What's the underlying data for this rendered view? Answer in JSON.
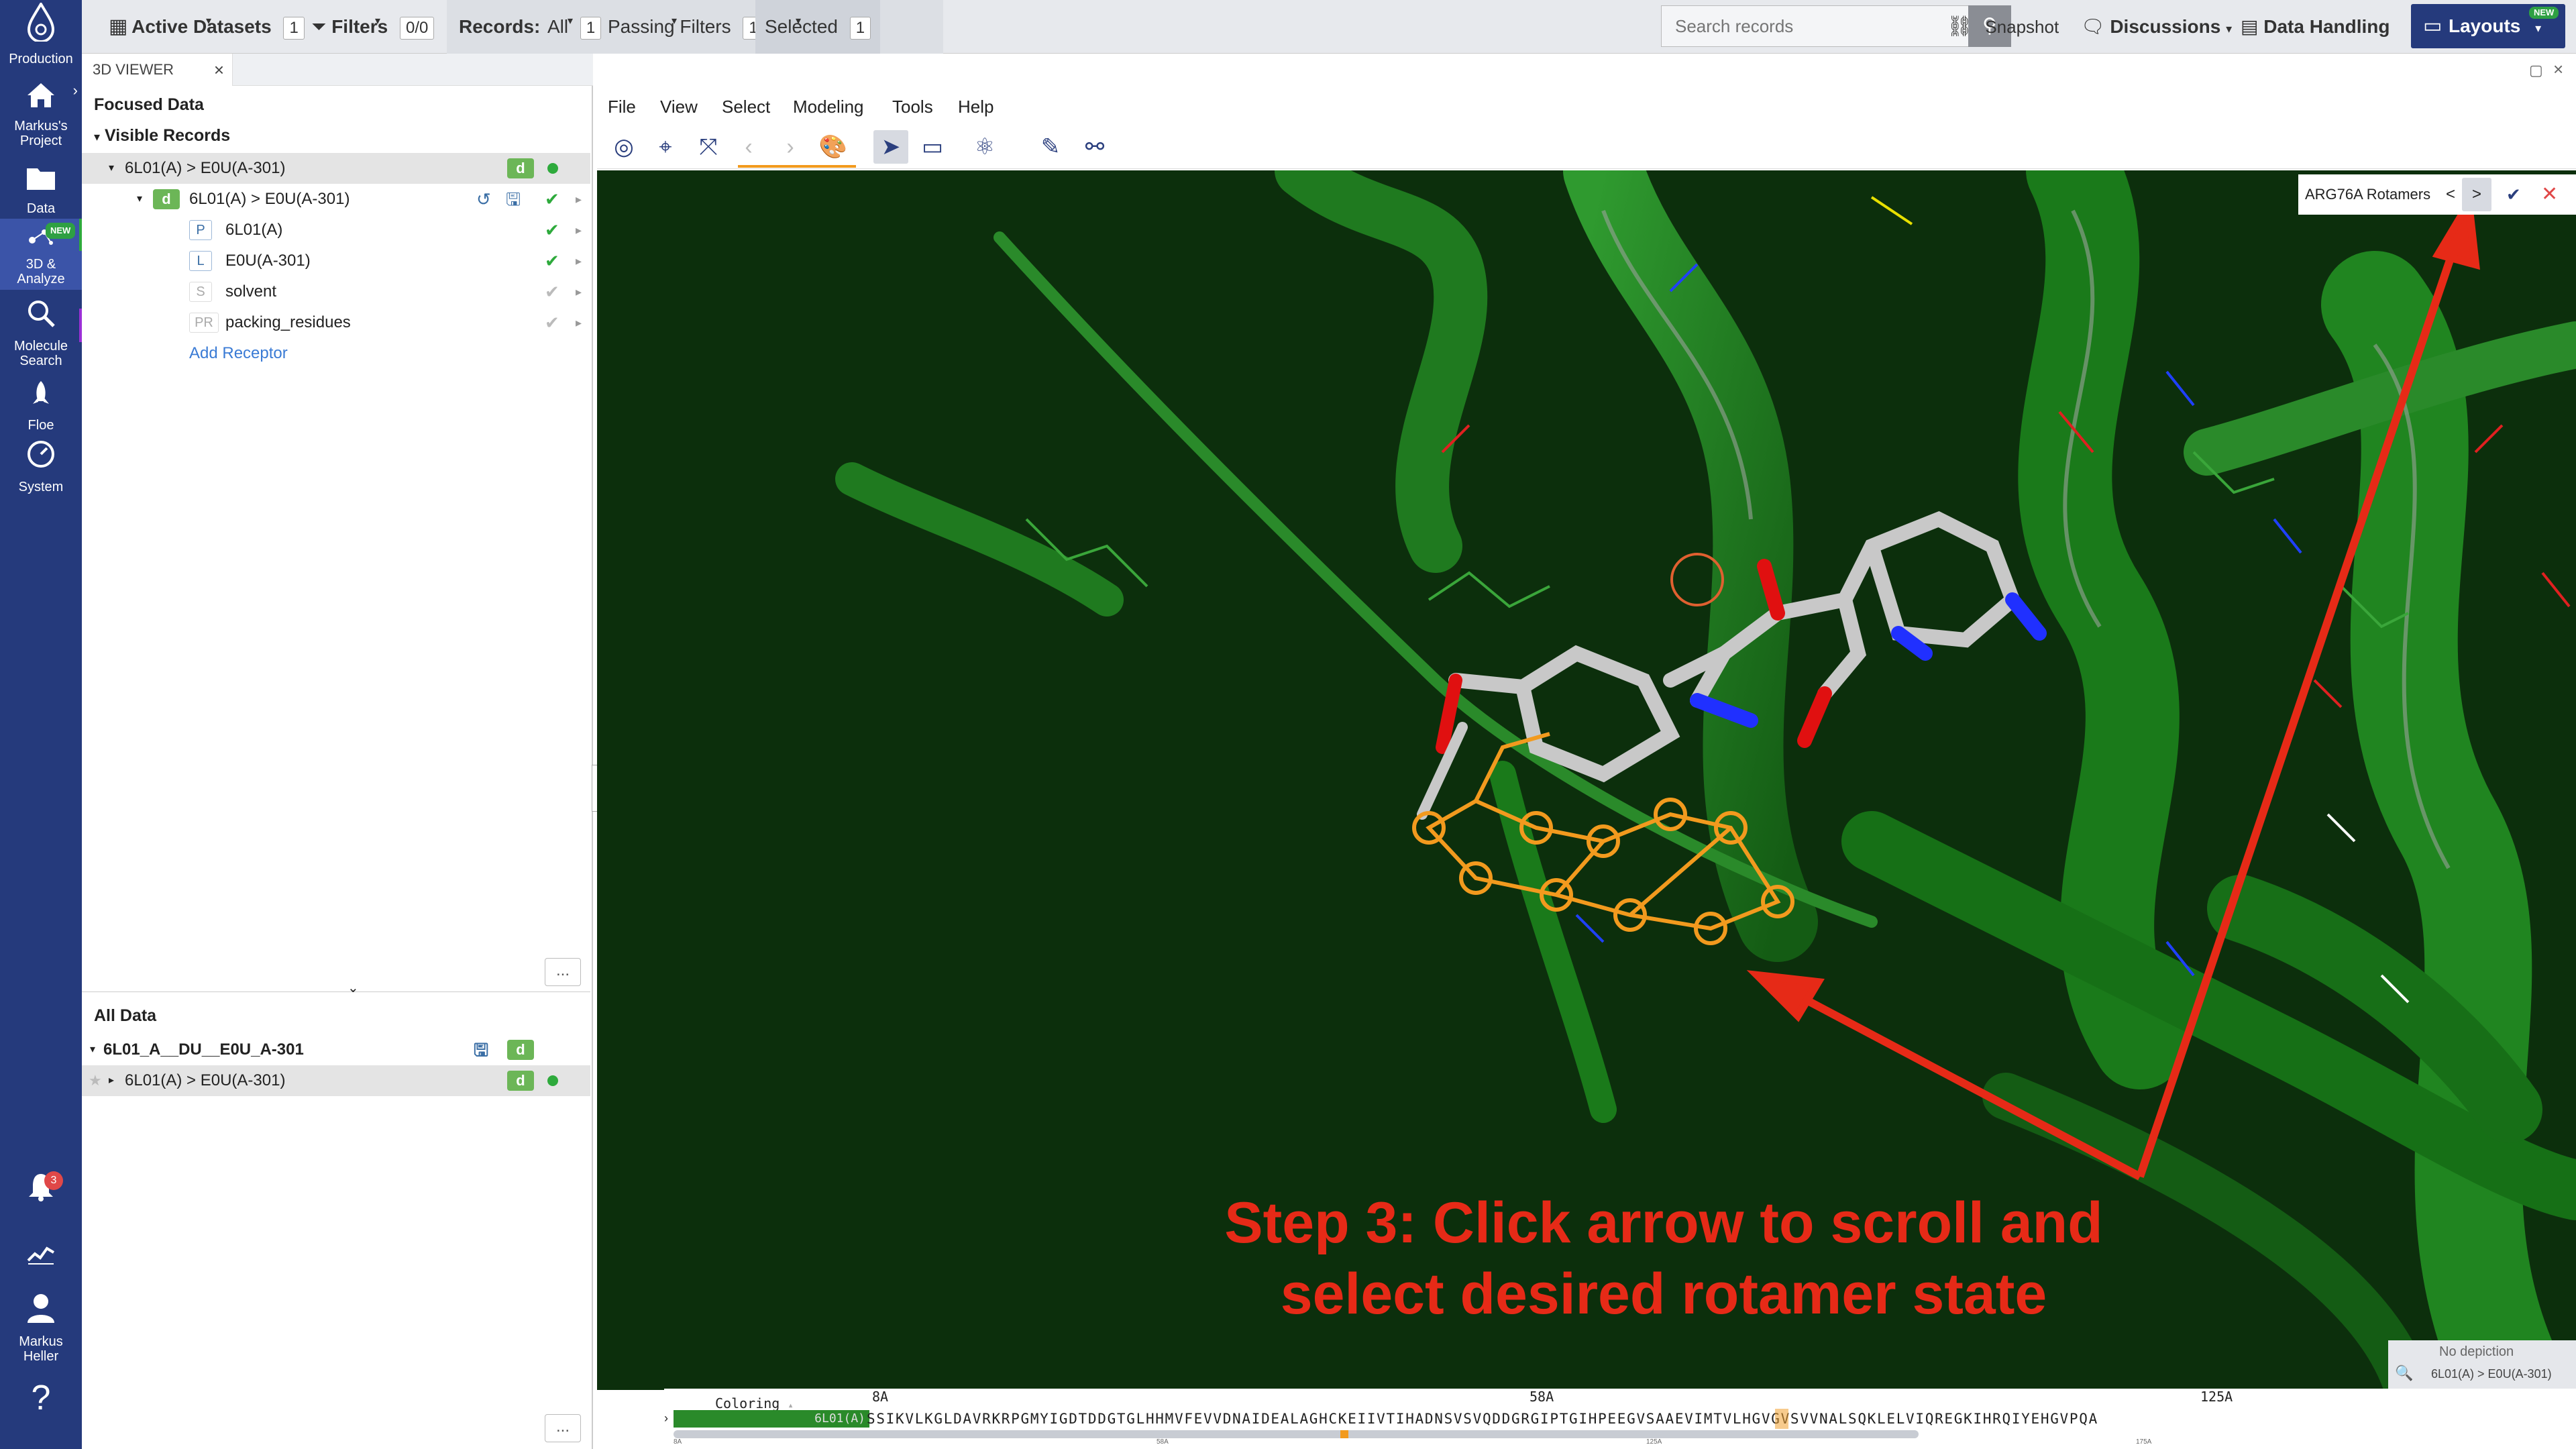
{
  "nav": {
    "items": [
      {
        "id": "production",
        "label": "Production",
        "icon": "logo-drop-icon"
      },
      {
        "id": "project",
        "label1": "Markus's",
        "label2": "Project",
        "icon": "home-icon"
      },
      {
        "id": "data",
        "label": "Data",
        "icon": "folder-icon"
      },
      {
        "id": "analyze",
        "label1": "3D &",
        "label2": "Analyze",
        "icon": "molecule-icon",
        "badge": "NEW"
      },
      {
        "id": "molsearch",
        "label1": "Molecule",
        "label2": "Search",
        "icon": "search-icon"
      },
      {
        "id": "floe",
        "label": "Floe",
        "icon": "rocket-icon"
      },
      {
        "id": "system",
        "label": "System",
        "icon": "gauge-icon"
      }
    ],
    "notifications_count": "3",
    "user_first": "Markus",
    "user_last": "Heller",
    "help": "?"
  },
  "topbar": {
    "active_datasets": "Active Datasets",
    "active_datasets_count": "1",
    "filters": "Filters",
    "filters_count": "0/0",
    "records_label": "Records:",
    "all": "All",
    "all_count": "1",
    "passing": "Passing Filters",
    "passing_count": "1",
    "selected": "Selected",
    "selected_count": "1",
    "search_placeholder": "Search records",
    "snapshot": "Snapshot",
    "discussions": "Discussions",
    "data_handling": "Data Handling",
    "layouts": "Layouts",
    "layouts_badge": "NEW"
  },
  "panel": {
    "tab": "3D VIEWER",
    "focused": "Focused Data",
    "visible": "Visible Records",
    "rows": [
      {
        "label": "6L01(A) > E0U(A-301)"
      },
      {
        "label": "6L01(A) > E0U(A-301)",
        "badge": "d"
      },
      {
        "label": "6L01(A)",
        "pill": "P"
      },
      {
        "label": "E0U(A-301)",
        "pill": "L"
      },
      {
        "label": "solvent",
        "pill": "S"
      },
      {
        "label": "packing_residues",
        "pill": "PR"
      }
    ],
    "add_receptor": "Add Receptor",
    "all_data": "All Data",
    "dataset": "6L01_A__DU__E0U_A-301",
    "dataset_row": "6L01(A) > E0U(A-301)",
    "badge_d": "d",
    "more": "..."
  },
  "viewer": {
    "menu": [
      "File",
      "View",
      "Select",
      "Modeling",
      "Tools",
      "Help"
    ],
    "rotamer_title": "ARG76A Rotamers",
    "prev": "<",
    "next": ">",
    "callout_line1": "Step 3: Click arrow to scroll and",
    "callout_line2": "select desired rotamer state",
    "no_depiction": "No depiction",
    "no_depiction_sub": "6L01(A) > E0U(A-301)"
  },
  "sequence": {
    "coloring": "Coloring",
    "chain": "6L01(A)",
    "marks": [
      "8A",
      "58A",
      "125A"
    ],
    "seq": "SSIKVLKGLDAVRKRPGMYIGDTDDGTGLHHMVFEVVDNAIDEALAGHCKEIIVTIHADNSVSVQDDGRGIPTGIHPEEGVSAAEVIMTVLHGVGVSVVNALSQKLELVIQREGKIHRQIYEHGVPQA",
    "ticks": [
      "8A",
      "58A",
      "125A",
      "175A"
    ]
  },
  "colors": {
    "nav": "#253a7c",
    "ribbon": "#1f7a1f",
    "background": "#0c2f0c",
    "callout": "#e62a17",
    "ligand_outline": "#f29a1e"
  }
}
